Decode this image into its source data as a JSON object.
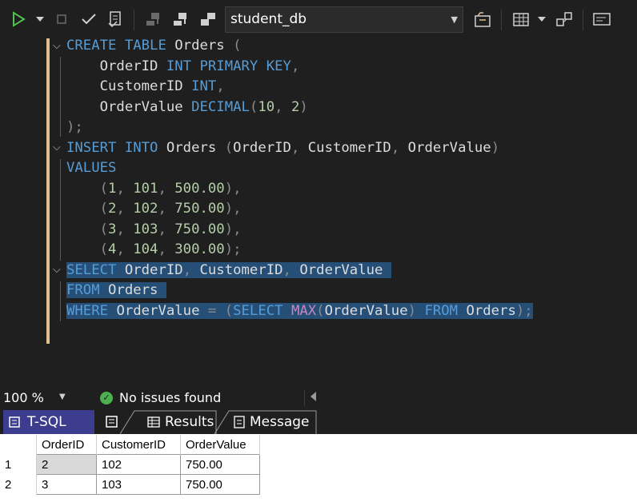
{
  "toolbar": {
    "database": "student_db",
    "icons": [
      "play-icon",
      "dropdown-icon",
      "stop-icon",
      "check-icon",
      "parse-icon",
      "connect-icon",
      "disconnect-icon",
      "change-connection-icon",
      "folder-icon",
      "grid-icon",
      "plan-icon",
      "results-icon"
    ]
  },
  "editor": {
    "lines": [
      [
        [
          "kw",
          "CREATE "
        ],
        [
          "kw",
          "TABLE "
        ],
        [
          "id",
          "Orders "
        ],
        [
          "pu",
          "("
        ]
      ],
      [
        [
          "id",
          "    OrderID "
        ],
        [
          "kw",
          "INT "
        ],
        [
          "kw",
          "PRIMARY "
        ],
        [
          "kw",
          "KEY"
        ],
        [
          "pu",
          ","
        ]
      ],
      [
        [
          "id",
          "    CustomerID "
        ],
        [
          "kw",
          "INT"
        ],
        [
          "pu",
          ","
        ]
      ],
      [
        [
          "id",
          "    OrderValue "
        ],
        [
          "kw",
          "DECIMAL"
        ],
        [
          "pu",
          "("
        ],
        [
          "num",
          "10"
        ],
        [
          "pu",
          ", "
        ],
        [
          "num",
          "2"
        ],
        [
          "pu",
          ")"
        ]
      ],
      [
        [
          "pu",
          ");"
        ]
      ],
      [
        [
          "kw",
          "INSERT "
        ],
        [
          "kw",
          "INTO "
        ],
        [
          "id",
          "Orders "
        ],
        [
          "pu",
          "("
        ],
        [
          "id",
          "OrderID"
        ],
        [
          "pu",
          ", "
        ],
        [
          "id",
          "CustomerID"
        ],
        [
          "pu",
          ", "
        ],
        [
          "id",
          "OrderValue"
        ],
        [
          "pu",
          ")"
        ]
      ],
      [
        [
          "kw",
          "VALUES"
        ]
      ],
      [
        [
          "pu",
          "    ("
        ],
        [
          "num",
          "1"
        ],
        [
          "pu",
          ", "
        ],
        [
          "num",
          "101"
        ],
        [
          "pu",
          ", "
        ],
        [
          "num",
          "500.00"
        ],
        [
          "pu",
          "),"
        ]
      ],
      [
        [
          "pu",
          "    ("
        ],
        [
          "num",
          "2"
        ],
        [
          "pu",
          ", "
        ],
        [
          "num",
          "102"
        ],
        [
          "pu",
          ", "
        ],
        [
          "num",
          "750.00"
        ],
        [
          "pu",
          "),"
        ]
      ],
      [
        [
          "pu",
          "    ("
        ],
        [
          "num",
          "3"
        ],
        [
          "pu",
          ", "
        ],
        [
          "num",
          "103"
        ],
        [
          "pu",
          ", "
        ],
        [
          "num",
          "750.00"
        ],
        [
          "pu",
          "),"
        ]
      ],
      [
        [
          "pu",
          "    ("
        ],
        [
          "num",
          "4"
        ],
        [
          "pu",
          ", "
        ],
        [
          "num",
          "104"
        ],
        [
          "pu",
          ", "
        ],
        [
          "num",
          "300.00"
        ],
        [
          "pu",
          ");"
        ]
      ],
      [
        [
          "kw",
          "SELECT "
        ],
        [
          "id",
          "OrderID"
        ],
        [
          "pu",
          ", "
        ],
        [
          "id",
          "CustomerID"
        ],
        [
          "pu",
          ", "
        ],
        [
          "id",
          "OrderValue "
        ]
      ],
      [
        [
          "kw",
          "FROM "
        ],
        [
          "id",
          "Orders "
        ]
      ],
      [
        [
          "kw",
          "WHERE "
        ],
        [
          "id",
          "OrderValue "
        ],
        [
          "pu",
          "= ("
        ],
        [
          "kw",
          "SELECT "
        ],
        [
          "fn",
          "MAX"
        ],
        [
          "pu",
          "("
        ],
        [
          "id",
          "OrderValue"
        ],
        [
          "pu",
          ") "
        ],
        [
          "kw",
          "FROM "
        ],
        [
          "id",
          "Orders"
        ],
        [
          "pu",
          ");"
        ]
      ]
    ],
    "selected_lines": [
      11,
      12,
      13
    ]
  },
  "status": {
    "zoom": "100 %",
    "issues": "No issues found"
  },
  "tabs": {
    "tsql": "T-SQL",
    "results": "Results",
    "message": "Message"
  },
  "results": {
    "columns": [
      "OrderID",
      "CustomerID",
      "OrderValue"
    ],
    "rows": [
      {
        "rownum": "1",
        "cells": [
          "2",
          "102",
          "750.00"
        ]
      },
      {
        "rownum": "2",
        "cells": [
          "3",
          "103",
          "750.00"
        ]
      }
    ]
  },
  "colors": {
    "selection": "#264f78",
    "keyword": "#569cd6",
    "number": "#b5cea8",
    "function": "#c586c0",
    "tab_active": "#3d3d8f"
  }
}
